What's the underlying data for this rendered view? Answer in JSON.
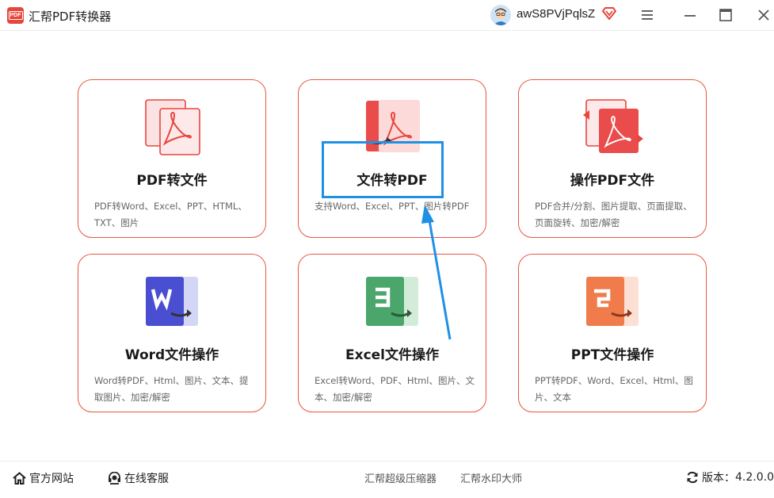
{
  "app": {
    "title": "汇帮PDF转换器",
    "logo_text": "PDF",
    "username": "awS8PVjPqlsZ"
  },
  "cards": [
    {
      "title": "PDF转文件",
      "desc": "PDF转Word、Excel、PPT、HTML、TXT、图片",
      "icon": "pdf-to-file-icon"
    },
    {
      "title": "文件转PDF",
      "desc": "支持Word、Excel、PPT、图片转PDF",
      "icon": "file-to-pdf-icon"
    },
    {
      "title": "操作PDF文件",
      "desc": "PDF合并/分割、图片提取、页面提取、页面旋转、加密/解密",
      "icon": "operate-pdf-icon"
    },
    {
      "title": "Word文件操作",
      "desc": "Word转PDF、Html、图片、文本、提取图片、加密/解密",
      "icon": "word-icon"
    },
    {
      "title": "Excel文件操作",
      "desc": "Excel转Word、PDF、Html、图片、文本、加密/解密",
      "icon": "excel-icon"
    },
    {
      "title": "PPT文件操作",
      "desc": "PPT转PDF、Word、Excel、Html、图片、文本",
      "icon": "ppt-icon"
    }
  ],
  "footer": {
    "official_site": "官方网站",
    "online_service": "在线客服",
    "link_compressor": "汇帮超级压缩器",
    "link_watermark": "汇帮水印大师",
    "version_label": "版本：",
    "version_value": "4.2.0.0"
  },
  "colors": {
    "accent": "#e8573f",
    "highlight": "#1e90e6",
    "word": "#4a4fd1",
    "excel": "#4aa66a",
    "ppt": "#f07c4c"
  }
}
